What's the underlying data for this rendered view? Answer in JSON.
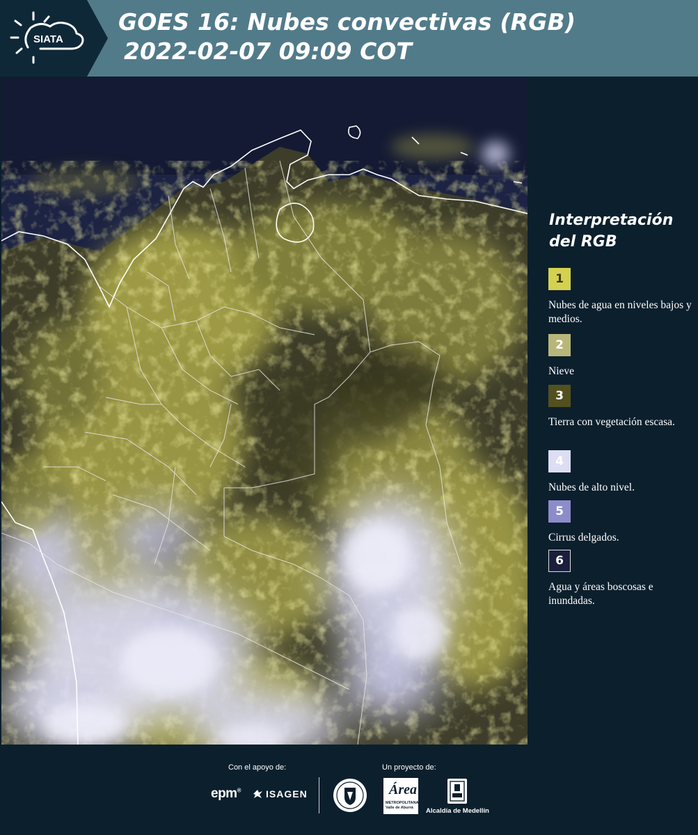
{
  "header": {
    "logo_text": "SIATA",
    "title_line1": "GOES 16: Nubes convectivas (RGB)",
    "title_line2": "2022-02-07 09:09 COT"
  },
  "legend": {
    "title": "Interpretación del RGB",
    "items": [
      {
        "number": "1",
        "label": "Nubes de agua en niveles bajos y medios.",
        "color": "#d4d150",
        "text_color": "#3a3a10"
      },
      {
        "number": "2",
        "label": "Nieve",
        "color": "#b9b67a",
        "text_color": "#ffffff"
      },
      {
        "number": "3",
        "label": "Tierra con vegetación escasa.",
        "color": "#535020",
        "text_color": "#ffffff"
      },
      {
        "number": "4",
        "label": "Nubes de alto nivel.",
        "color": "#ddddf4",
        "text_color": "#ffffff"
      },
      {
        "number": "5",
        "label": "Cirrus delgados.",
        "color": "#8c8ccb",
        "text_color": "#ffffff"
      },
      {
        "number": "6",
        "label": "Agua y áreas boscosas e inundadas.",
        "color": "#1b1f3d",
        "text_color": "#ffffff"
      }
    ]
  },
  "footer": {
    "support_label": "Con el apoyo de:",
    "project_label": "Un proyecto de:",
    "epm": "epm",
    "isagen": "ISAGEN",
    "area_name": "Área",
    "area_sub1": "METROPOLITANA",
    "area_sub2": "Valle de Aburrá",
    "alcaldia": "Alcaldía de Medellín"
  },
  "colors": {
    "header_bg": "#527b8a",
    "page_bg": "#0c1f2d",
    "ocean": "#1a2140",
    "low_cloud": "#c9c35a",
    "high_cloud": "#d9d9f2"
  }
}
